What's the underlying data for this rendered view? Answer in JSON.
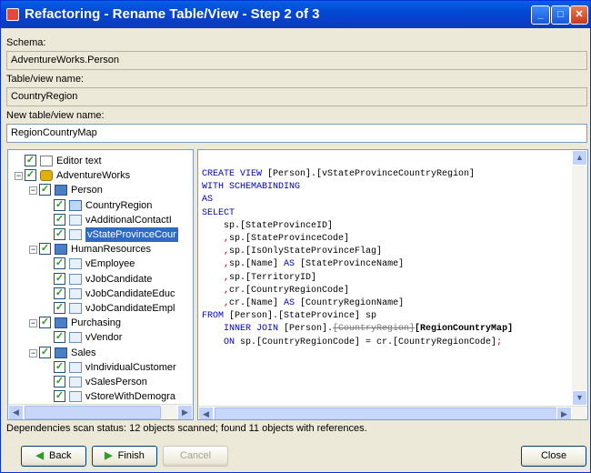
{
  "window": {
    "title": "Refactoring - Rename Table/View - Step 2 of 3"
  },
  "fields": {
    "schema_label": "Schema:",
    "schema_value": "AdventureWorks.Person",
    "table_label": "Table/view name:",
    "table_value": "CountryRegion",
    "new_label": "New table/view name:",
    "new_value": "RegionCountryMap"
  },
  "tree": [
    {
      "label": "Editor text",
      "level": 0,
      "icon": "doc-icon",
      "expander": ""
    },
    {
      "label": "AdventureWorks",
      "level": 0,
      "icon": "database-icon",
      "expander": "−"
    },
    {
      "label": "Person",
      "level": 1,
      "icon": "folder-icon",
      "expander": "−"
    },
    {
      "label": "CountryRegion",
      "level": 2,
      "icon": "table-icon",
      "expander": ""
    },
    {
      "label": "vAdditionalContactI",
      "level": 2,
      "icon": "view-icon",
      "expander": ""
    },
    {
      "label": "vStateProvinceCour",
      "level": 2,
      "icon": "view-icon",
      "expander": "",
      "selected": true
    },
    {
      "label": "HumanResources",
      "level": 1,
      "icon": "folder-icon",
      "expander": "−"
    },
    {
      "label": "vEmployee",
      "level": 2,
      "icon": "view-icon",
      "expander": ""
    },
    {
      "label": "vJobCandidate",
      "level": 2,
      "icon": "view-icon",
      "expander": ""
    },
    {
      "label": "vJobCandidateEduc",
      "level": 2,
      "icon": "view-icon",
      "expander": ""
    },
    {
      "label": "vJobCandidateEmpl",
      "level": 2,
      "icon": "view-icon",
      "expander": ""
    },
    {
      "label": "Purchasing",
      "level": 1,
      "icon": "folder-icon",
      "expander": "−"
    },
    {
      "label": "vVendor",
      "level": 2,
      "icon": "view-icon",
      "expander": ""
    },
    {
      "label": "Sales",
      "level": 1,
      "icon": "folder-icon",
      "expander": "−"
    },
    {
      "label": "vIndividualCustomer",
      "level": 2,
      "icon": "view-icon",
      "expander": ""
    },
    {
      "label": "vSalesPerson",
      "level": 2,
      "icon": "view-icon",
      "expander": ""
    },
    {
      "label": "vStoreWithDemogra",
      "level": 2,
      "icon": "view-icon",
      "expander": ""
    }
  ],
  "code": {
    "l1a": "CREATE VIEW",
    "l1b": " [Person].[vStateProvinceCountryRegion]",
    "l2": "WITH SCHEMABINDING",
    "l3": "AS",
    "l4": "SELECT",
    "l5": "    sp.[StateProvinceID]",
    "l6a": "    ,",
    "l6b": "sp.[StateProvinceCode]",
    "l7a": "    ,",
    "l7b": "sp.[IsOnlyStateProvinceFlag]",
    "l8a": "    ,",
    "l8b": "sp.[Name] ",
    "l8c": "AS",
    "l8d": " [StateProvinceName]",
    "l9a": "    ,",
    "l9b": "sp.[TerritoryID]",
    "l10a": "    ,",
    "l10b": "cr.[CountryRegionCode]",
    "l11a": "    ,",
    "l11b": "cr.[Name] ",
    "l11c": "AS",
    "l11d": " [CountryRegionName]",
    "l12a": "FROM",
    "l12b": " [Person].[StateProvince] sp",
    "l13a": "    INNER JOIN",
    "l13b": " [Person].",
    "l13c": "[CountryRegion]",
    "l13d": "[RegionCountryMap]",
    "l14a": "    ON",
    "l14b": " sp.[CountryRegionCode] = cr.[CountryRegionCode]",
    "l14c": ";"
  },
  "status": "Dependencies scan status: 12 objects scanned; found 11 objects with references.",
  "buttons": {
    "back": "Back",
    "finish": "Finish",
    "cancel": "Cancel",
    "close": "Close"
  }
}
